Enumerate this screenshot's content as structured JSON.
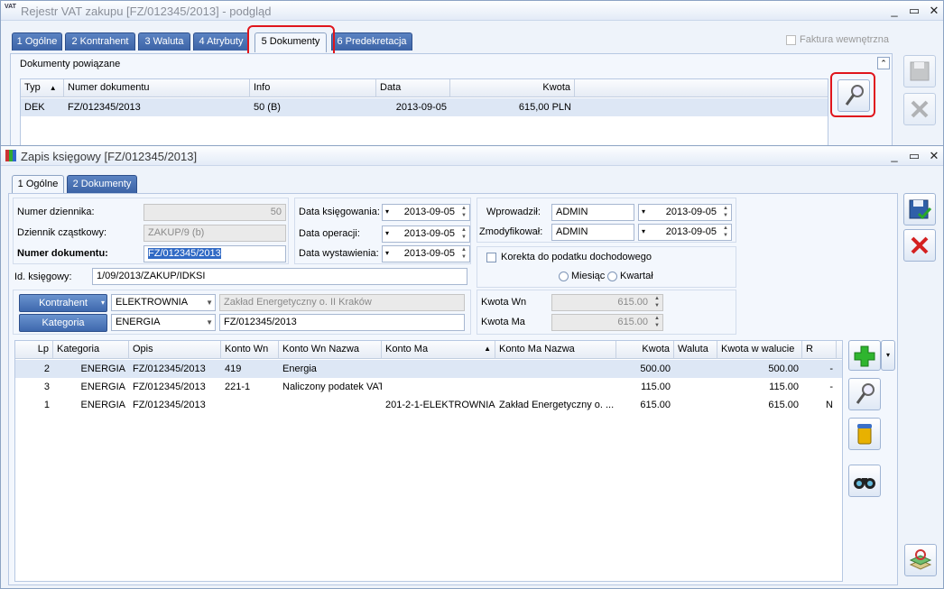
{
  "vat_window": {
    "title": "Rejestr VAT zakupu [FZ/012345/2013] - podgląd",
    "tabs": [
      "1 Ogólne",
      "2 Kontrahent",
      "3 Waluta",
      "4 Atrybuty",
      "5 Dokumenty",
      "6 Predekretacja"
    ],
    "active_tab": "5 Dokumenty",
    "internal_invoice_label": "Faktura wewnętrzna",
    "section_title": "Dokumenty powiązane",
    "columns": [
      "Typ",
      "Numer dokumentu",
      "Info",
      "Data",
      "Kwota"
    ],
    "rows": [
      {
        "typ": "DEK",
        "numer": "FZ/012345/2013",
        "info": "50 (B)",
        "data": "2013-09-05",
        "kwota": "615,00 PLN"
      }
    ]
  },
  "entry_window": {
    "title": "Zapis księgowy [FZ/012345/2013]",
    "tabs": [
      "1 Ogólne",
      "2 Dokumenty"
    ],
    "labels": {
      "numer_dziennika": "Numer dziennika:",
      "dziennik_czastkowy": "Dziennik cząstkowy:",
      "numer_dokumentu": "Numer dokumentu:",
      "id_ksiegowy": "Id. księgowy:",
      "data_ksiegowania": "Data księgowania:",
      "data_operacji": "Data operacji:",
      "data_wystawienia": "Data wystawienia:",
      "wprowadzil": "Wprowadził:",
      "zmodyfikowal": "Zmodyfikował:",
      "korekta": "Korekta do podatku dochodowego",
      "miesiac": "Miesiąc",
      "kwartal": "Kwartał",
      "kwota_wn": "Kwota Wn",
      "kwota_ma": "Kwota Ma",
      "kontrahent_btn": "Kontrahent",
      "kategoria_btn": "Kategoria"
    },
    "values": {
      "numer_dziennika": "50",
      "dziennik_czastkowy": "ZAKUP/9 (b)",
      "numer_dokumentu": "FZ/012345/2013",
      "id_ksiegowy": "1/09/2013/ZAKUP/IDKSI",
      "data_ksiegowania": "2013-09-05",
      "data_operacji": "2013-09-05",
      "data_wystawienia": "2013-09-05",
      "wprowadzil_user": "ADMIN",
      "wprowadzil_date": "2013-09-05",
      "zmodyfikowal_user": "ADMIN",
      "zmodyfikowal_date": "2013-09-05",
      "kontrahent_code": "ELEKTROWNIA",
      "kontrahent_name": "Zakład Energetyczny o. II Kraków",
      "kategoria_code": "ENERGIA",
      "kategoria_desc": "FZ/012345/2013",
      "kwota_wn": "615.00",
      "kwota_ma": "615.00"
    },
    "grid_columns": [
      "Lp",
      "Kategoria",
      "Opis",
      "Konto Wn",
      "Konto Wn Nazwa",
      "Konto Ma",
      "Konto Ma Nazwa",
      "Kwota",
      "Waluta",
      "Kwota w walucie",
      "R"
    ],
    "grid_rows": [
      {
        "lp": "2",
        "kategoria": "ENERGIA",
        "opis": "FZ/012345/2013",
        "konto_wn": "419",
        "konto_wn_nazwa": "Energia",
        "konto_ma": "",
        "konto_ma_nazwa": "",
        "kwota": "500.00",
        "waluta": "",
        "kwota_w_walucie": "500.00",
        "r": "-"
      },
      {
        "lp": "3",
        "kategoria": "ENERGIA",
        "opis": "FZ/012345/2013",
        "konto_wn": "221-1",
        "konto_wn_nazwa": "Naliczony podatek VAT",
        "konto_ma": "",
        "konto_ma_nazwa": "",
        "kwota": "115.00",
        "waluta": "",
        "kwota_w_walucie": "115.00",
        "r": "-"
      },
      {
        "lp": "1",
        "kategoria": "ENERGIA",
        "opis": "FZ/012345/2013",
        "konto_wn": "",
        "konto_wn_nazwa": "",
        "konto_ma": "201-2-1-ELEKTROWNIA",
        "konto_ma_nazwa": "Zakład Energetyczny o. ...",
        "kwota": "615.00",
        "waluta": "",
        "kwota_w_walucie": "615.00",
        "r": "N"
      }
    ]
  }
}
